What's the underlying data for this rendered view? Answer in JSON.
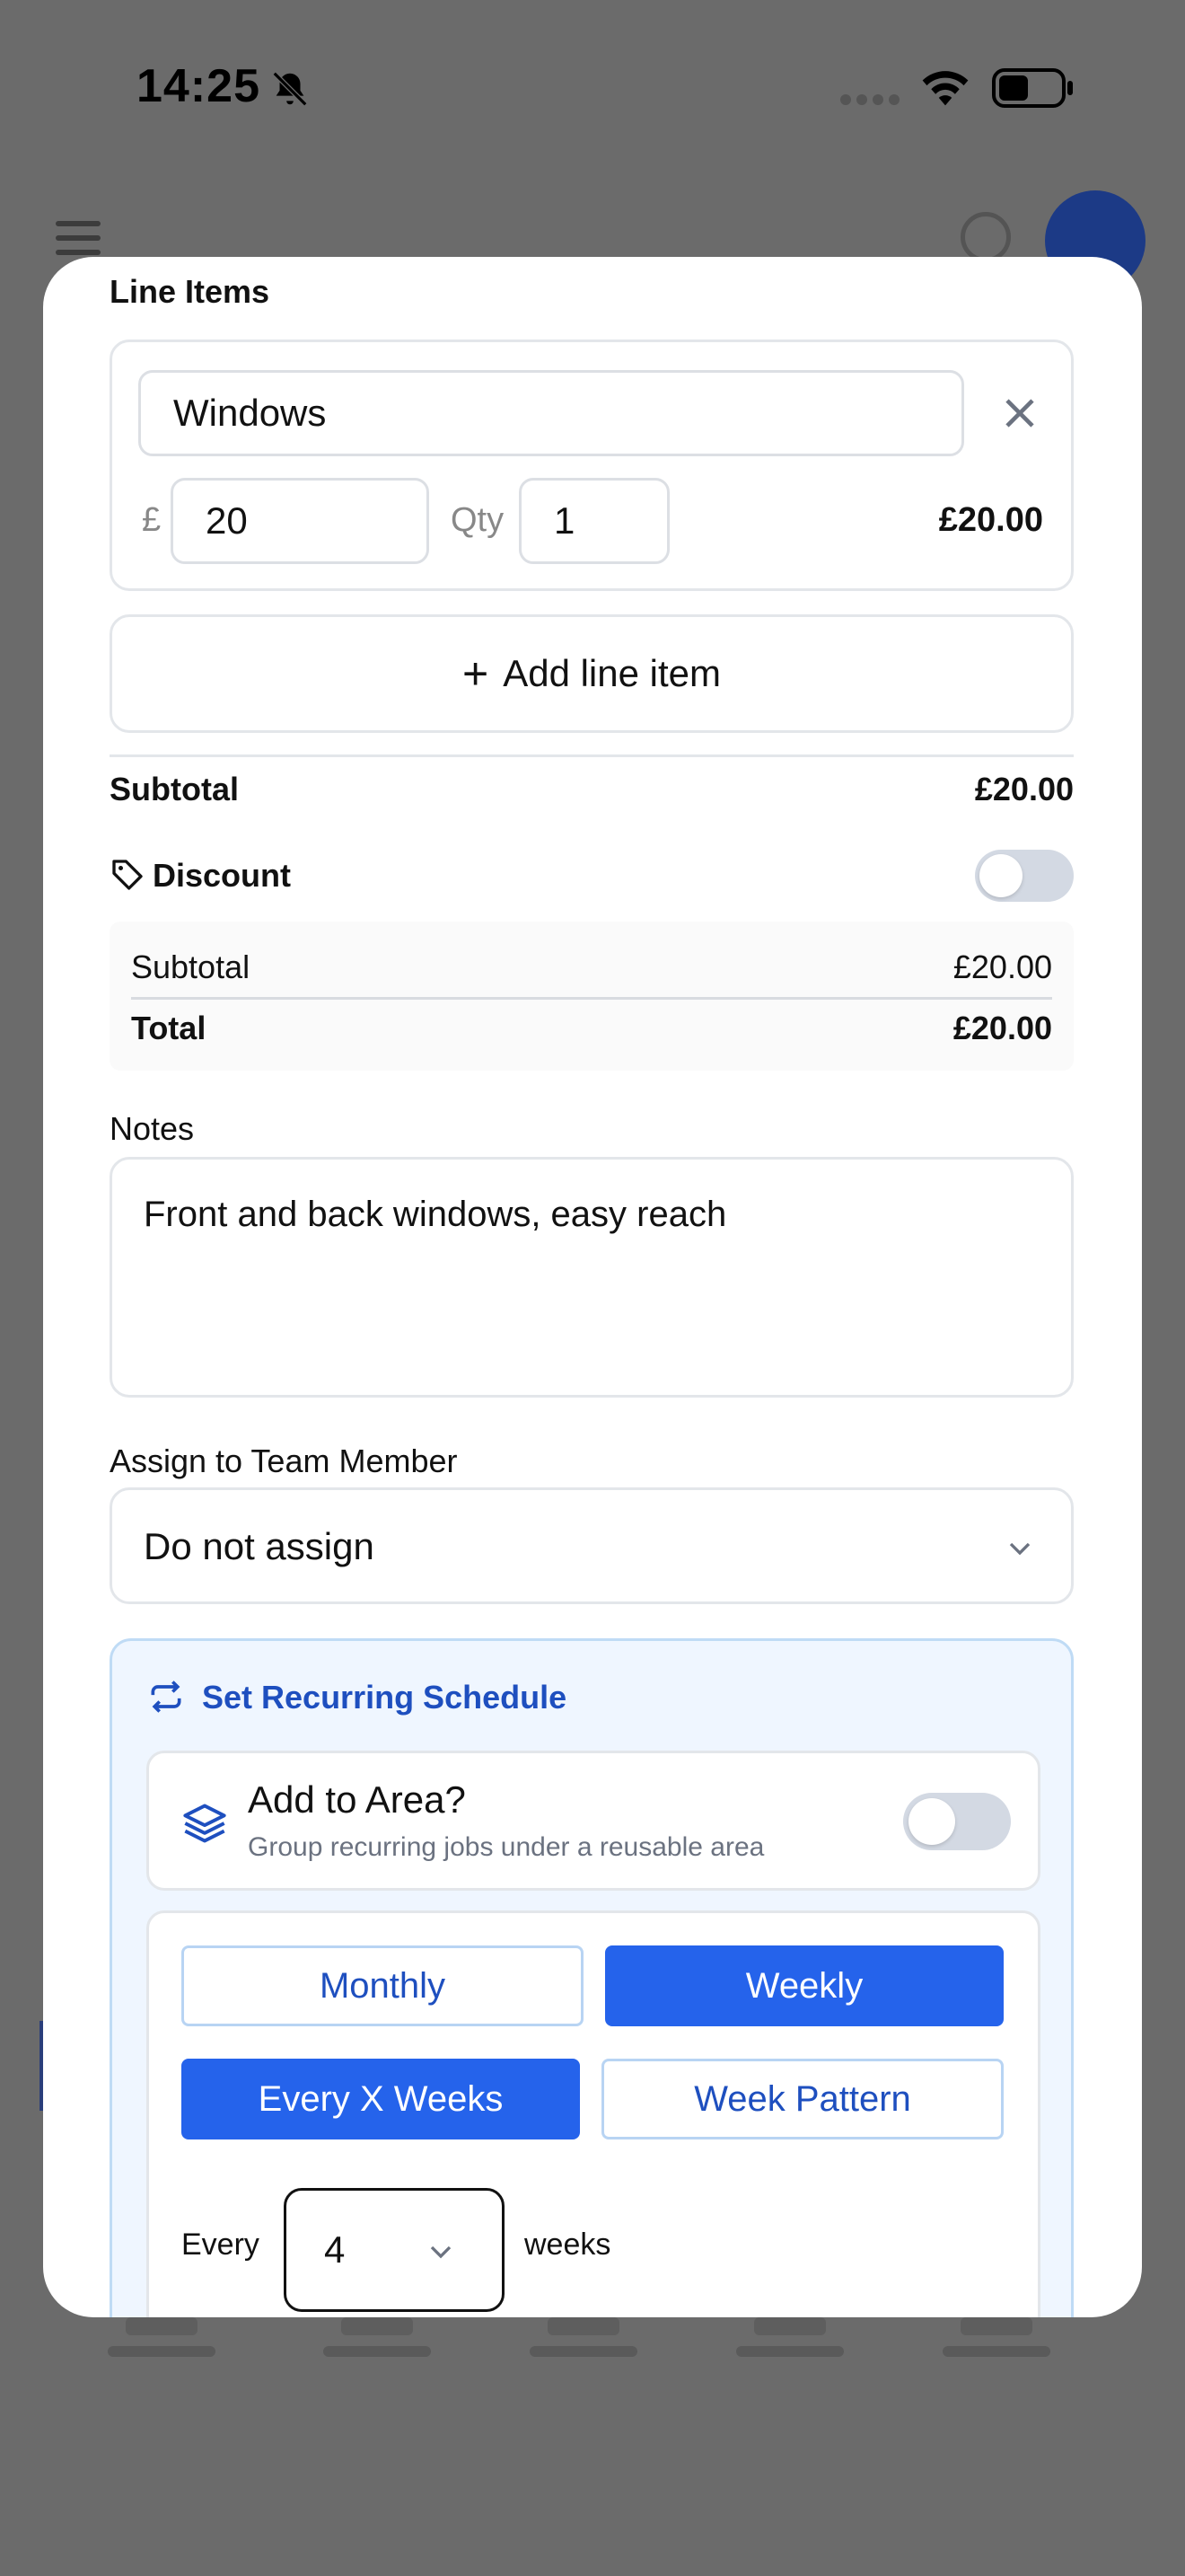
{
  "status_bar": {
    "time": "14:25"
  },
  "line_items": {
    "label": "Line Items",
    "items": [
      {
        "name": "Windows",
        "currency": "£",
        "price": "20",
        "qty_label": "Qty",
        "qty": "1",
        "total": "£20.00"
      }
    ],
    "add_label": "Add line item"
  },
  "totals": {
    "subtotal_label": "Subtotal",
    "subtotal_value": "£20.00",
    "discount_label": "Discount",
    "discount_enabled": false,
    "summary": {
      "subtotal_label": "Subtotal",
      "subtotal_value": "£20.00",
      "total_label": "Total",
      "total_value": "£20.00"
    }
  },
  "notes": {
    "label": "Notes",
    "value": "Front and back windows, easy reach"
  },
  "assign": {
    "label": "Assign to Team Member",
    "value": "Do not assign"
  },
  "recurring": {
    "title": "Set Recurring Schedule",
    "area": {
      "title": "Add to Area?",
      "subtitle": "Group recurring jobs under a reusable area",
      "enabled": false
    },
    "frequency": {
      "options": [
        {
          "label": "Monthly",
          "selected": false
        },
        {
          "label": "Weekly",
          "selected": true
        },
        {
          "label": "Every X Weeks",
          "selected": true
        },
        {
          "label": "Week Pattern",
          "selected": false
        }
      ],
      "every_label": "Every",
      "interval_value": "4",
      "unit_label": "weeks"
    }
  },
  "colors": {
    "accent": "#2563eb",
    "accent_text": "#1e4fbf",
    "recurring_bg": "#eff6ff",
    "toggle_off": "#d3d9e3"
  }
}
